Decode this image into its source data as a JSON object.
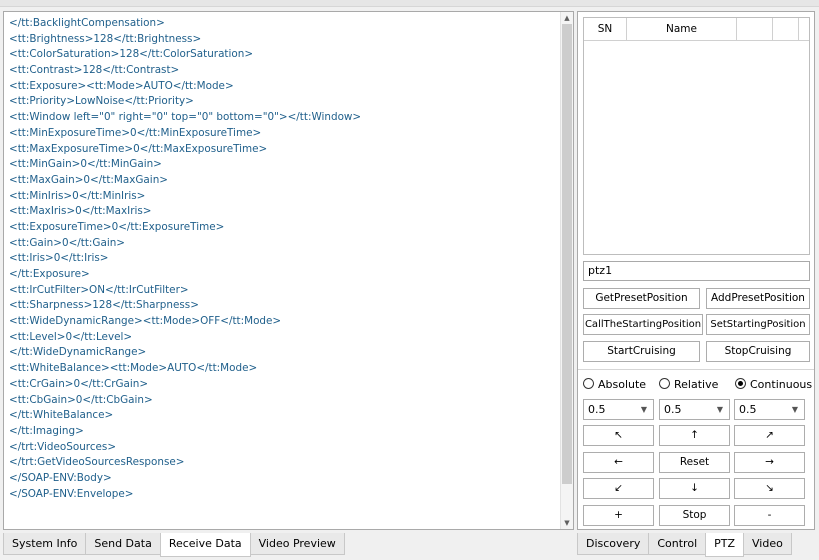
{
  "xml_lines": [
    "</tt:BacklightCompensation>",
    "<tt:Brightness>128</tt:Brightness>",
    "<tt:ColorSaturation>128</tt:ColorSaturation>",
    "<tt:Contrast>128</tt:Contrast>",
    "<tt:Exposure><tt:Mode>AUTO</tt:Mode>",
    "<tt:Priority>LowNoise</tt:Priority>",
    "<tt:Window left=\"0\" right=\"0\" top=\"0\" bottom=\"0\"></tt:Window>",
    "<tt:MinExposureTime>0</tt:MinExposureTime>",
    "<tt:MaxExposureTime>0</tt:MaxExposureTime>",
    "<tt:MinGain>0</tt:MinGain>",
    "<tt:MaxGain>0</tt:MaxGain>",
    "<tt:MinIris>0</tt:MinIris>",
    "<tt:MaxIris>0</tt:MaxIris>",
    "<tt:ExposureTime>0</tt:ExposureTime>",
    "<tt:Gain>0</tt:Gain>",
    "<tt:Iris>0</tt:Iris>",
    "</tt:Exposure>",
    "<tt:IrCutFilter>ON</tt:IrCutFilter>",
    "<tt:Sharpness>128</tt:Sharpness>",
    "<tt:WideDynamicRange><tt:Mode>OFF</tt:Mode>",
    "<tt:Level>0</tt:Level>",
    "</tt:WideDynamicRange>",
    "<tt:WhiteBalance><tt:Mode>AUTO</tt:Mode>",
    "<tt:CrGain>0</tt:CrGain>",
    "<tt:CbGain>0</tt:CbGain>",
    "</tt:WhiteBalance>",
    "</tt:Imaging>",
    "</trt:VideoSources>",
    "</trt:GetVideoSourcesResponse>",
    "</SOAP-ENV:Body>",
    "</SOAP-ENV:Envelope>"
  ],
  "left_tabs": [
    "System Info",
    "Send Data",
    "Receive Data",
    "Video Preview"
  ],
  "left_active_tab": "Receive Data",
  "right_tabs": [
    "Discovery",
    "Control",
    "PTZ",
    "Video"
  ],
  "right_active_tab": "PTZ",
  "preset_table": {
    "columns": [
      "SN",
      "Name",
      "",
      ""
    ]
  },
  "preset_name_value": "ptz1",
  "preset_buttons": [
    "GetPresetPosition",
    "AddPresetPosition",
    "CallTheStartingPosition",
    "SetStartingPosition",
    "StartCruising",
    "StopCruising"
  ],
  "move_modes": [
    {
      "label": "Absolute",
      "selected": false
    },
    {
      "label": "Relative",
      "selected": false
    },
    {
      "label": "Continuous",
      "selected": true
    }
  ],
  "speed_values": [
    "0.5",
    "0.5",
    "0.5"
  ],
  "ptz_buttons": [
    {
      "label": "↖",
      "icon": "arrow-up-left-icon"
    },
    {
      "label": "↑",
      "icon": "arrow-up-icon"
    },
    {
      "label": "↗",
      "icon": "arrow-up-right-icon"
    },
    {
      "label": "←",
      "icon": "arrow-left-icon"
    },
    {
      "label": "Reset",
      "icon": ""
    },
    {
      "label": "→",
      "icon": "arrow-right-icon"
    },
    {
      "label": "↙",
      "icon": "arrow-down-left-icon"
    },
    {
      "label": "↓",
      "icon": "arrow-down-icon"
    },
    {
      "label": "↘",
      "icon": "arrow-down-right-icon"
    },
    {
      "label": "+",
      "icon": "zoom-in-icon"
    },
    {
      "label": "Stop",
      "icon": ""
    },
    {
      "label": "-",
      "icon": "zoom-out-icon"
    }
  ],
  "colors": {
    "xml_text": "#1f5f8b",
    "border": "#a9a9a9"
  }
}
